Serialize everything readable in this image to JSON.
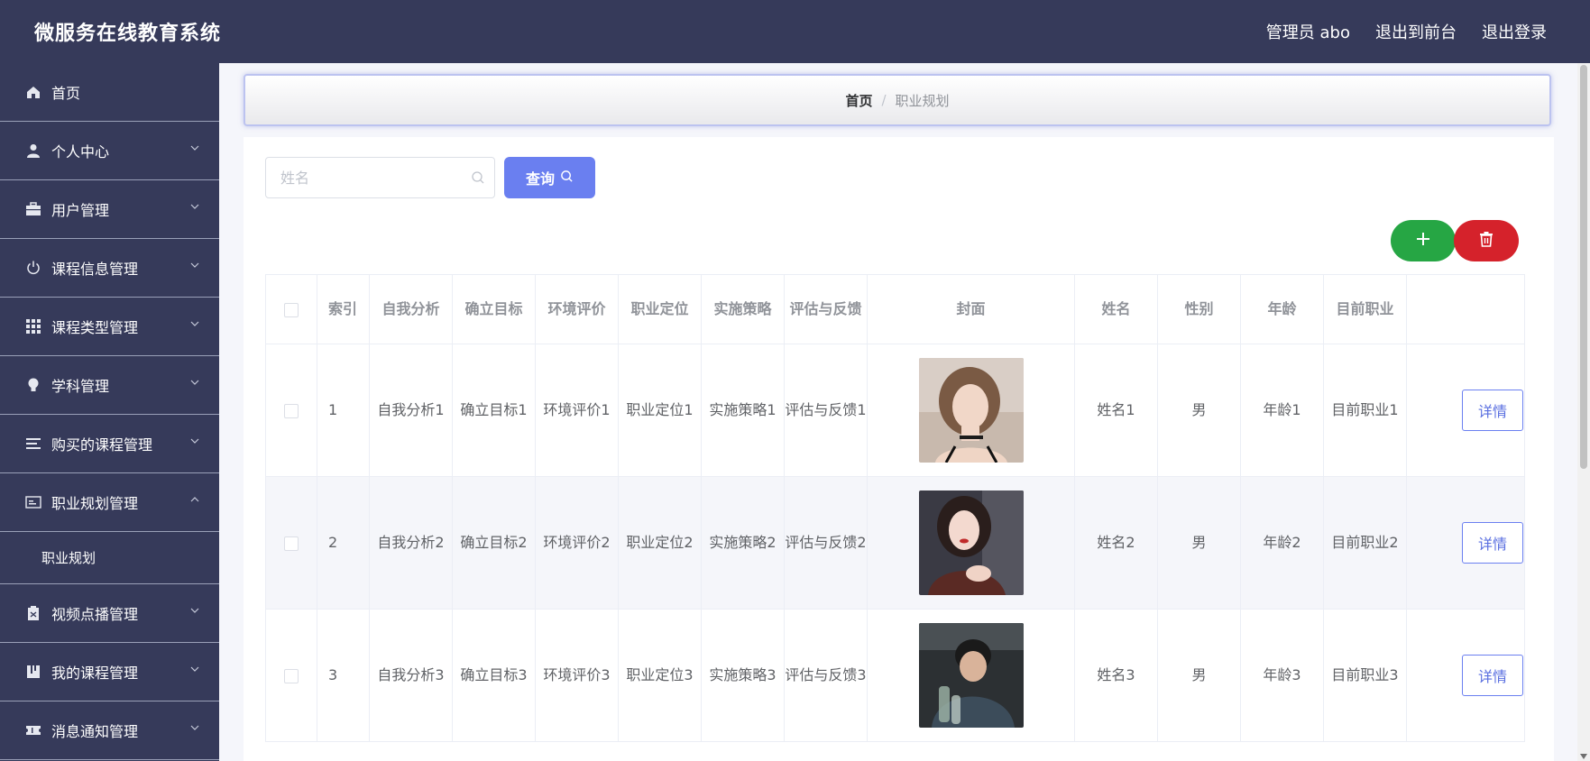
{
  "header": {
    "title": "微服务在线教育系统",
    "user_label": "管理员 abo",
    "front_label": "退出到前台",
    "logout_label": "退出登录"
  },
  "sidebar": {
    "items": [
      {
        "label": "首页",
        "icon": "home-icon"
      },
      {
        "label": "个人中心",
        "icon": "user-icon"
      },
      {
        "label": "用户管理",
        "icon": "briefcase-icon"
      },
      {
        "label": "课程信息管理",
        "icon": "power-icon"
      },
      {
        "label": "课程类型管理",
        "icon": "grid-icon"
      },
      {
        "label": "学科管理",
        "icon": "bulb-icon"
      },
      {
        "label": "购买的课程管理",
        "icon": "list-icon"
      },
      {
        "label": "职业规划管理",
        "icon": "card-icon"
      },
      {
        "label": "视频点播管理",
        "icon": "battery-icon"
      },
      {
        "label": "我的课程管理",
        "icon": "book-icon"
      },
      {
        "label": "消息通知管理",
        "icon": "ticket-icon"
      }
    ],
    "submenu_label": "职业规划"
  },
  "breadcrumb": {
    "home": "首页",
    "separator": "/",
    "current": "职业规划"
  },
  "search": {
    "placeholder": "姓名",
    "value": "",
    "button_label": "查询"
  },
  "table": {
    "headers": [
      "索引",
      "自我分析",
      "确立目标",
      "环境评价",
      "职业定位",
      "实施策略",
      "评估与反馈",
      "封面",
      "姓名",
      "性别",
      "年龄",
      "目前职业"
    ],
    "rows": [
      {
        "index": "1",
        "self": "自我分析1",
        "goal": "确立目标1",
        "env": "环境评价1",
        "position": "职业定位1",
        "strategy": "实施策略1",
        "feedback": "评估与反馈1",
        "name": "姓名1",
        "gender": "男",
        "age": "年龄1",
        "job": "目前职业1"
      },
      {
        "index": "2",
        "self": "自我分析2",
        "goal": "确立目标2",
        "env": "环境评价2",
        "position": "职业定位2",
        "strategy": "实施策略2",
        "feedback": "评估与反馈2",
        "name": "姓名2",
        "gender": "男",
        "age": "年龄2",
        "job": "目前职业2"
      },
      {
        "index": "3",
        "self": "自我分析3",
        "goal": "确立目标3",
        "env": "环境评价3",
        "position": "职业定位3",
        "strategy": "实施策略3",
        "feedback": "评估与反馈3",
        "name": "姓名3",
        "gender": "男",
        "age": "年龄3",
        "job": "目前职业3"
      }
    ],
    "detail_label": "详情"
  },
  "colors": {
    "sidebar_bg": "#363a5a",
    "primary": "#6a7ff0",
    "success": "#26a644",
    "danger": "#d5222b"
  }
}
